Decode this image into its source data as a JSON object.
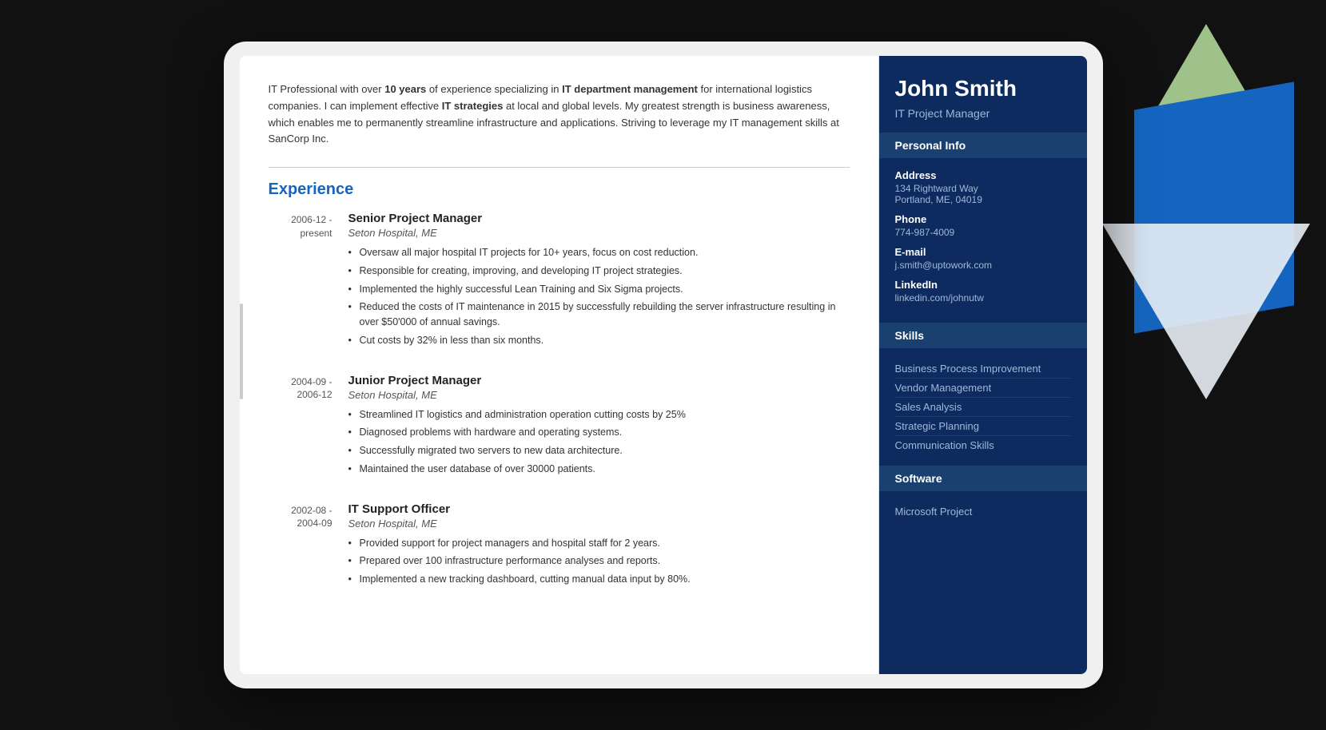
{
  "bg": {
    "color": "#1a1a1a"
  },
  "resume": {
    "summary": {
      "text_parts": [
        {
          "text": "IT Professional with over ",
          "bold": false
        },
        {
          "text": "10 years",
          "bold": true
        },
        {
          "text": " of experience specializing in ",
          "bold": false
        },
        {
          "text": "IT department management",
          "bold": true
        },
        {
          "text": " for international logistics companies. I can implement effective ",
          "bold": false
        },
        {
          "text": "IT strategies",
          "bold": true
        },
        {
          "text": " at local and global levels. My greatest strength is business awareness, which enables me to permanently streamline infrastructure and applications. Striving to leverage my IT management skills at SanCorp Inc.",
          "bold": false
        }
      ]
    },
    "sections": {
      "experience_title": "Experience",
      "jobs": [
        {
          "date": "2006-12 -\npresent",
          "title": "Senior Project Manager",
          "company": "Seton Hospital, ME",
          "bullets": [
            "Oversaw all major hospital IT projects for 10+ years, focus on cost reduction.",
            "Responsible for creating, improving, and developing IT project strategies.",
            "Implemented the highly successful Lean Training and Six Sigma projects.",
            "Reduced the costs of IT maintenance in 2015 by successfully rebuilding the server infrastructure resulting in over $50'000 of annual savings.",
            "Cut costs by 32% in less than six months."
          ]
        },
        {
          "date": "2004-09 -\n2006-12",
          "title": "Junior Project Manager",
          "company": "Seton Hospital, ME",
          "bullets": [
            "Streamlined IT logistics and administration operation cutting costs by 25%",
            "Diagnosed problems with hardware and operating systems.",
            "Successfully migrated two servers to new data architecture.",
            "Maintained the user database of over 30000 patients."
          ]
        },
        {
          "date": "2002-08 -\n2004-09",
          "title": "IT Support Officer",
          "company": "Seton Hospital, ME",
          "bullets": [
            "Provided support for project managers and hospital staff for 2 years.",
            "Prepared over 100 infrastructure performance analyses and reports.",
            "Implemented a new tracking dashboard, cutting manual data input by 80%."
          ]
        }
      ]
    }
  },
  "sidebar": {
    "name": "John Smith",
    "job_title": "IT Project Manager",
    "sections": {
      "personal_info": {
        "header": "Personal Info",
        "fields": [
          {
            "label": "Address",
            "value": "134 Rightward Way\nPortland, ME, 04019"
          },
          {
            "label": "Phone",
            "value": "774-987-4009"
          },
          {
            "label": "E-mail",
            "value": "j.smith@uptowork.com"
          },
          {
            "label": "LinkedIn",
            "value": "linkedin.com/johnutw"
          }
        ]
      },
      "skills": {
        "header": "Skills",
        "items": [
          "Business Process Improvement",
          "Vendor Management",
          "Sales Analysis",
          "Strategic Planning",
          "Communication Skills"
        ]
      },
      "software": {
        "header": "Software",
        "items": [
          "Microsoft Project"
        ]
      }
    }
  }
}
